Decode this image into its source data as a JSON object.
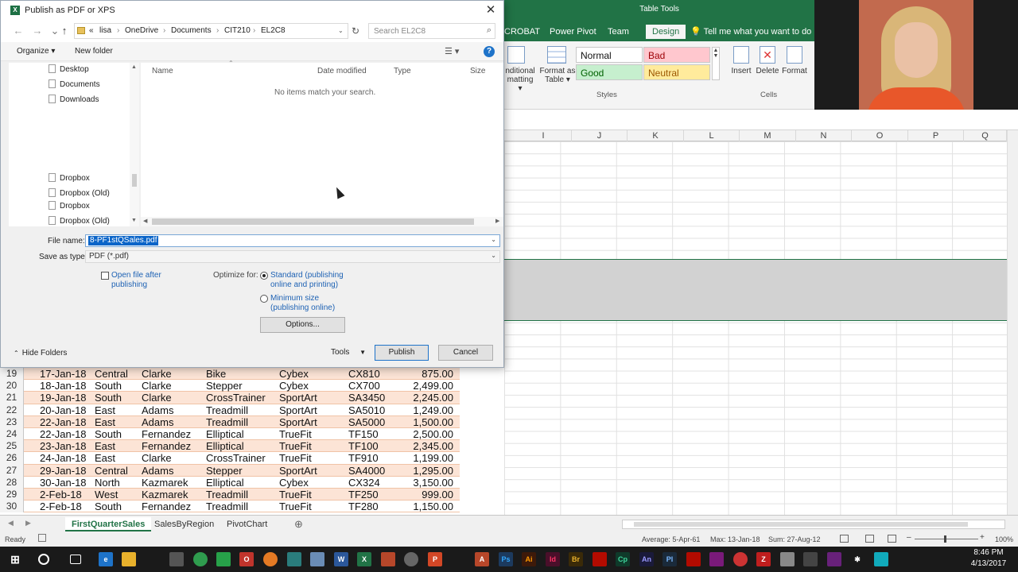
{
  "dialog": {
    "title": "Publish as PDF or XPS",
    "title_icon": "X",
    "close_icon": "✕",
    "breadcrumb": [
      "«",
      "lisa",
      "OneDrive",
      "Documents",
      "CIT210",
      "EL2C8"
    ],
    "search_placeholder": "Search EL2C8",
    "organize_label": "Organize ▾",
    "new_folder_label": "New folder",
    "help_icon": "?",
    "nav_items": [
      "Desktop",
      "Documents",
      "Downloads",
      "Dropbox",
      "Dropbox (Old)",
      "Dropbox",
      "Dropbox (Old)"
    ],
    "columns": [
      "Name",
      "Date modified",
      "Type",
      "Size"
    ],
    "empty_message": "No items match your search.",
    "file_name_label": "File name:",
    "file_name_value": "8-PF1stQSales.pdf",
    "save_type_label": "Save as type:",
    "save_type_value": "PDF (*.pdf)",
    "open_after_label": "Open file after publishing",
    "open_after_checked": false,
    "optimize_label": "Optimize for:",
    "optimize_standard": "Standard (publishing online and printing)",
    "optimize_minimum": "Minimum size (publishing online)",
    "options_label": "Options...",
    "hide_folders_label": "Hide Folders",
    "tools_label": "Tools",
    "publish_label": "Publish",
    "cancel_label": "Cancel"
  },
  "ribbon": {
    "context_title": "Table Tools",
    "tabs": [
      "CROBAT",
      "Power Pivot",
      "Team",
      "Design"
    ],
    "tell_me": "Tell me what you want to do",
    "styles": {
      "normal": "Normal",
      "bad": "Bad",
      "good": "Good",
      "neutral": "Neutral"
    },
    "cond_format_label": "nditional matting ▾",
    "format_as_table_label": "Format as Table ▾",
    "styles_group": "Styles",
    "insert_label": "Insert",
    "delete_label": "Delete",
    "format_label": "Format",
    "cells_group": "Cells",
    "accent_color": "#217346"
  },
  "sheet": {
    "column_letters": [
      "I",
      "J",
      "K",
      "L",
      "M",
      "N",
      "O",
      "P",
      "Q"
    ],
    "rows": [
      {
        "n": "19",
        "date": "17-Jan-18",
        "region": "Central",
        "rep": "Clarke",
        "product": "Bike",
        "mfr": "Cybex",
        "code": "CX810",
        "amount": "875.00"
      },
      {
        "n": "20",
        "date": "18-Jan-18",
        "region": "South",
        "rep": "Clarke",
        "product": "Stepper",
        "mfr": "Cybex",
        "code": "CX700",
        "amount": "2,499.00"
      },
      {
        "n": "21",
        "date": "19-Jan-18",
        "region": "South",
        "rep": "Clarke",
        "product": "CrossTrainer",
        "mfr": "SportArt",
        "code": "SA3450",
        "amount": "2,245.00"
      },
      {
        "n": "22",
        "date": "20-Jan-18",
        "region": "East",
        "rep": "Adams",
        "product": "Treadmill",
        "mfr": "SportArt",
        "code": "SA5010",
        "amount": "1,249.00"
      },
      {
        "n": "23",
        "date": "22-Jan-18",
        "region": "East",
        "rep": "Adams",
        "product": "Treadmill",
        "mfr": "SportArt",
        "code": "SA5000",
        "amount": "1,500.00"
      },
      {
        "n": "24",
        "date": "22-Jan-18",
        "region": "South",
        "rep": "Fernandez",
        "product": "Elliptical",
        "mfr": "TrueFit",
        "code": "TF150",
        "amount": "2,500.00"
      },
      {
        "n": "25",
        "date": "23-Jan-18",
        "region": "East",
        "rep": "Fernandez",
        "product": "Elliptical",
        "mfr": "TrueFit",
        "code": "TF100",
        "amount": "2,345.00"
      },
      {
        "n": "26",
        "date": "24-Jan-18",
        "region": "East",
        "rep": "Clarke",
        "product": "CrossTrainer",
        "mfr": "TrueFit",
        "code": "TF910",
        "amount": "1,199.00"
      },
      {
        "n": "27",
        "date": "29-Jan-18",
        "region": "Central",
        "rep": "Adams",
        "product": "Stepper",
        "mfr": "SportArt",
        "code": "SA4000",
        "amount": "1,295.00"
      },
      {
        "n": "28",
        "date": "30-Jan-18",
        "region": "North",
        "rep": "Kazmarek",
        "product": "Elliptical",
        "mfr": "Cybex",
        "code": "CX324",
        "amount": "3,150.00"
      },
      {
        "n": "29",
        "date": "2-Feb-18",
        "region": "West",
        "rep": "Kazmarek",
        "product": "Treadmill",
        "mfr": "TrueFit",
        "code": "TF250",
        "amount": "999.00"
      },
      {
        "n": "30",
        "date": "2-Feb-18",
        "region": "South",
        "rep": "Fernandez",
        "product": "Treadmill",
        "mfr": "TrueFit",
        "code": "TF280",
        "amount": "1,150.00"
      }
    ],
    "tabs": [
      "FirstQuarterSales",
      "SalesByRegion",
      "PivotChart"
    ],
    "add_sheet_icon": "⊕"
  },
  "status": {
    "ready": "Ready",
    "average": "Average: 5-Apr-61",
    "max": "Max: 13-Jan-18",
    "sum": "Sum: 27-Aug-12",
    "zoom": "100%"
  },
  "taskbar": {
    "time": "8:46 PM",
    "date": "4/13/2017"
  }
}
